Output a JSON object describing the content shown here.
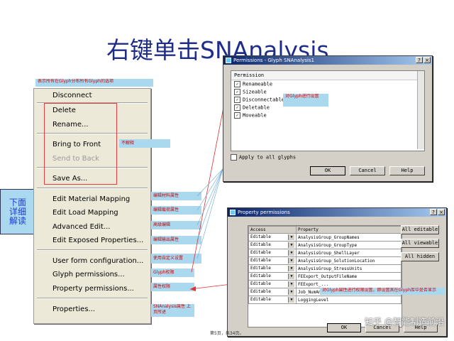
{
  "title": "右键单击SNAnalysis",
  "top_note": "表示所有在Glyph分布所有Glyph的选项",
  "side_label": "下面详细解读",
  "context_menu": {
    "items": [
      "Disconnect",
      "Delete",
      "Rename...",
      "Bring to Front",
      "Send to Back",
      "Save As...",
      "Edit Material Mapping",
      "Edit Load Mapping",
      "Advanced Edit...",
      "Edit Exposed Properties...",
      "User form configuration...",
      "Glyph permissions...",
      "Property permissions...",
      "Properties..."
    ]
  },
  "annotations": {
    "bring_front": "不解释",
    "edit_material": "编辑材料属性",
    "edit_load": "编辑载荷属性",
    "advanced": "高级编辑",
    "exposed": "编辑输出属性",
    "user_form": "使用自定义设置",
    "glyph_perm": "Glyph权限",
    "prop_perm": "属性权限",
    "properties": "SNAnalysis属性 上页所述",
    "perm_dialog": "对Glyph进行设置",
    "prop_dialog": "对Glyph属性进行权限设置，即设置其在Glyph库中是否显示"
  },
  "perm_dialog": {
    "title": "Permissions - Glyph SNAnalysis1",
    "header": "Permission",
    "items": [
      "Renameable",
      "Sizeable",
      "Disconnectable",
      "Deletable",
      "Moveable"
    ],
    "apply_all": "Apply to all glyphs",
    "ok": "OK",
    "cancel": "Cancel",
    "help": "Help"
  },
  "prop_dialog": {
    "title": "Property permissions",
    "col_access": "Access",
    "col_property": "Property",
    "rows": [
      {
        "access": "Editable",
        "prop": "AnalysisGroup_GroupNames"
      },
      {
        "access": "Editable",
        "prop": "AnalysisGroup_GroupType"
      },
      {
        "access": "Editable",
        "prop": "AnalysisGroup_ShellLayer"
      },
      {
        "access": "Editable",
        "prop": "AnalysisGroup_SolutionLocation"
      },
      {
        "access": "Editable",
        "prop": "AnalysisGroup_StressUnits"
      },
      {
        "access": "Editable",
        "prop": "FEExport_OutputFileName"
      },
      {
        "access": "Editable",
        "prop": "FEExport_..."
      },
      {
        "access": "Editable",
        "prop": "Job_NumAnalysisThreads"
      },
      {
        "access": "Editable",
        "prop": "LoggingLevel"
      }
    ],
    "btn_all_editable": "All editable",
    "btn_all_viewable": "All viewable",
    "btn_all_hidden": "All hidden",
    "ok": "OK",
    "cancel": "Cancel",
    "help": "Help"
  },
  "watermark": "知乎 @智能制造前沿",
  "page_number": "第5页，共34页。",
  "colors": {
    "note_bg": "#a9d8ef",
    "note_text": "#cc0000",
    "title": "#1f2d8a",
    "arrow": "#e03030",
    "title_bar": "#0a246a"
  }
}
